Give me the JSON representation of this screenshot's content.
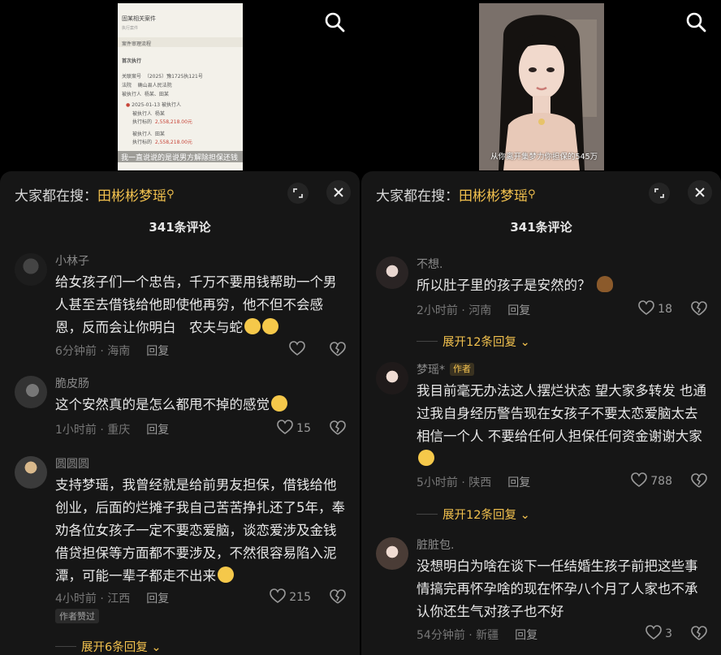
{
  "left": {
    "doc_thumb": {
      "title": "固某相关案件",
      "tag": "执行案件",
      "section1": "案件审理流程",
      "section2": "首次执行",
      "case_no_label": "关联案号",
      "case_no": "（2025）豫1725执121号",
      "court_label": "法院",
      "court": "确山县人民法院",
      "party_label": "被执行人",
      "party": "杨某、田某",
      "date": "2025-01-13",
      "event": "被执行人",
      "p1_label": "被执行人",
      "p1": "杨某",
      "amt_label": "执行标的",
      "amt": "2,558,218.00元",
      "p2": "田某",
      "amt2": "2,558,218.00元",
      "subtitle": "我一直说说的是说男方解除担保还钱"
    },
    "search_bar": {
      "prefix": "大家都在搜：",
      "keyword": "田彬彬梦瑶"
    },
    "count": "341条评论",
    "comments": [
      {
        "user": "小林子",
        "text": "给女孩子们一个忠告，千万不要用钱帮助一个男人甚至去借钱给他即使他再穷，他不但不会感恩，反而会让你明白　农夫与蛇",
        "time": "6分钟前 · 海南",
        "reply": "回复",
        "likes": ""
      },
      {
        "user": "脆皮肠",
        "text": "这个安然真的是怎么都甩不掉的感觉",
        "time": "1小时前 · 重庆",
        "reply": "回复",
        "likes": "15"
      },
      {
        "user": "圆圆圆",
        "text": "支持梦瑶，我曾经就是给前男友担保，借钱给他创业，后面的烂摊子我自己苦苦挣扎还了5年，奉劝各位女孩子一定不要恋爱脑，谈恋爱涉及金钱借贷担保等方面都不要涉及，不然很容易陷入泥潭，可能一辈子都走不出来",
        "time": "4小时前 · 江西",
        "reply": "回复",
        "likes": "215",
        "badge": "作者赞过",
        "expand": "展开6条回复"
      }
    ]
  },
  "right": {
    "subtitle": "从你离开集梦力你担保的545万",
    "search_bar": {
      "prefix": "大家都在搜：",
      "keyword": "田彬彬梦瑶"
    },
    "count": "341条评论",
    "comments": [
      {
        "user": "不想.",
        "text": "所以肚子里的孩子是安然的？",
        "time": "2小时前 · 河南",
        "reply": "回复",
        "likes": "18",
        "expand": "展开12条回复"
      },
      {
        "user": "梦瑶*",
        "author_tag": "作者",
        "text": "我目前毫无办法这人摆烂状态 望大家多转发 也通过我自身经历警告现在女孩子不要太恋爱脑太去相信一个人 不要给任何人担保任何资金谢谢大家",
        "time": "5小时前 · 陕西",
        "reply": "回复",
        "likes": "788",
        "expand": "展开12条回复"
      },
      {
        "user": "脏脏包.",
        "text": "没想明白为啥在谈下一任结婚生孩子前把这些事情搞完再怀孕啥的现在怀孕八个月了人家也不承认你还生气对孩子也不好",
        "time": "54分钟前 · 新疆",
        "reply": "回复",
        "likes": "3"
      }
    ]
  }
}
